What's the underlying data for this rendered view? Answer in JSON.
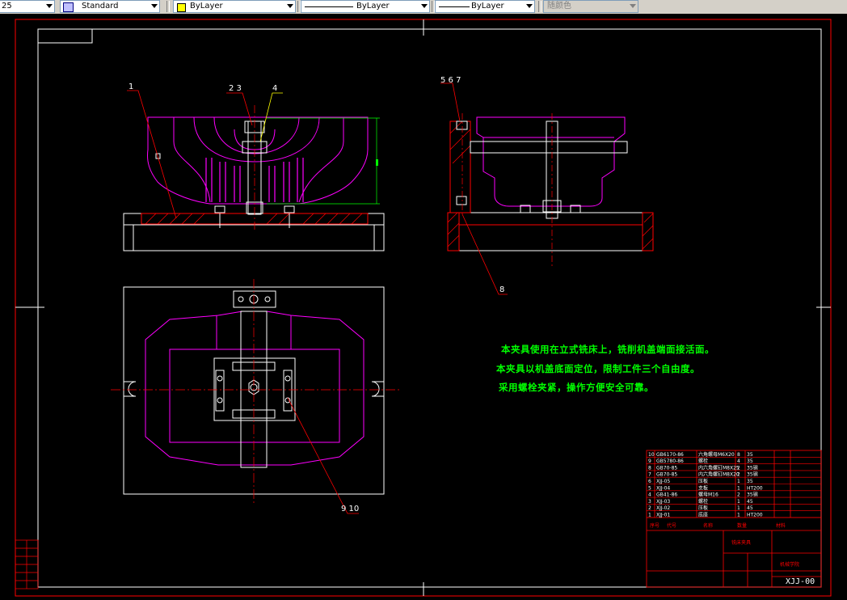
{
  "toolbar": {
    "left_value": "25",
    "text_style": "Standard",
    "layer": "ByLayer",
    "linetype": "ByLayer",
    "lineweight": "ByLayer",
    "plot_style": "随颜色"
  },
  "drawing": {
    "balloons": [
      "1",
      "2 3",
      "4",
      "5 6 7",
      "8",
      "9 10"
    ],
    "notes": [
      "本夹具使用在立式铣床上，铣削机盖端面接活面。",
      "本夹具以机盖底面定位，限制工件三个自由度。",
      "采用螺栓夹紧，操作方便安全可靠。"
    ],
    "drawing_number": "XJJ-00",
    "colors": {
      "border": "#ffffff",
      "outline": "#ffffff",
      "workpiece": "#ff00ff",
      "section": "#ff0000",
      "dimension": "#00ff00",
      "notes": "#00ff00",
      "leader_yellow": "#ffff00"
    }
  },
  "parts_list": {
    "rows": [
      {
        "no": "10",
        "code": "GB6170-86",
        "name": "六角螺母M6X20",
        "qty": "8",
        "material": "35"
      },
      {
        "no": "9",
        "code": "GB5780-86",
        "name": "螺栓",
        "qty": "4",
        "material": "35"
      },
      {
        "no": "8",
        "code": "GB70-85",
        "name": "内六角螺钉M8X25",
        "qty": "2",
        "material": "35钢"
      },
      {
        "no": "7",
        "code": "GB70-85",
        "name": "内六角螺钉M8X20",
        "qty": "2",
        "material": "35钢"
      },
      {
        "no": "6",
        "code": "XJJ-05",
        "name": "压板",
        "qty": "1",
        "material": "35"
      },
      {
        "no": "5",
        "code": "XJJ-04",
        "name": "支板",
        "qty": "1",
        "material": "HT200"
      },
      {
        "no": "4",
        "code": "GB41-86",
        "name": "螺母M16",
        "qty": "2",
        "material": "35钢"
      },
      {
        "no": "3",
        "code": "XJJ-03",
        "name": "螺栓",
        "qty": "1",
        "material": "45"
      },
      {
        "no": "2",
        "code": "XJJ-02",
        "name": "压板",
        "qty": "1",
        "material": "45"
      },
      {
        "no": "1",
        "code": "XJJ-01",
        "name": "底座",
        "qty": "1",
        "material": "HT200"
      }
    ],
    "header": [
      "序号",
      "代号",
      "名称",
      "数量",
      "材料"
    ],
    "title": "铣床夹具",
    "school_block": "机械学院"
  }
}
